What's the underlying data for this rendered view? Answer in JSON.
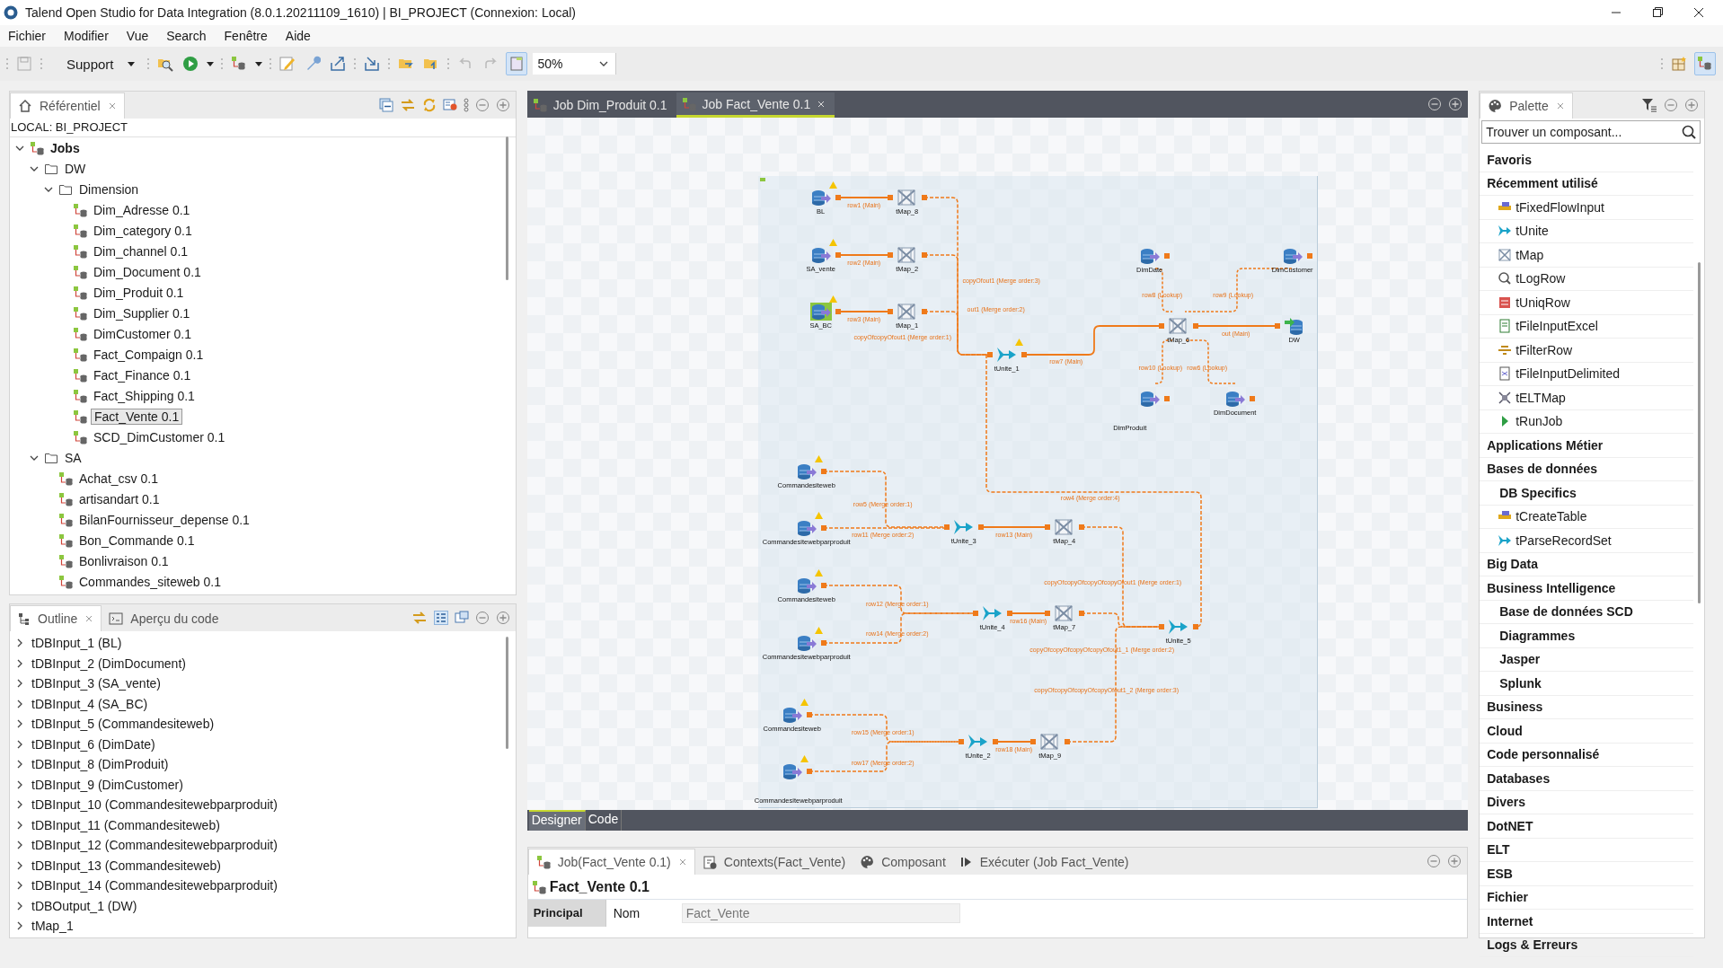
{
  "window": {
    "title": "Talend Open Studio for Data Integration (8.0.1.20211109_1610) | BI_PROJECT (Connexion: Local)"
  },
  "menu": [
    "Fichier",
    "Modifier",
    "Vue",
    "Search",
    "Fenêtre",
    "Aide"
  ],
  "toolbar": {
    "perspective": "Support",
    "zoom": "50%"
  },
  "repository": {
    "tab": "Référentiel",
    "location": "LOCAL: BI_PROJECT",
    "tree": [
      {
        "label": "Jobs",
        "kind": "root",
        "expanded": true,
        "selected": false,
        "children": [
          {
            "label": "DW",
            "kind": "folder",
            "expanded": true,
            "selected": false,
            "children": [
              {
                "label": "Dimension",
                "kind": "folder",
                "expanded": true,
                "selected": false,
                "children": [
                  {
                    "label": "Dim_Adresse 0.1",
                    "kind": "job",
                    "selected": false
                  },
                  {
                    "label": "Dim_category 0.1",
                    "kind": "job",
                    "selected": false
                  },
                  {
                    "label": "Dim_channel 0.1",
                    "kind": "job",
                    "selected": false
                  },
                  {
                    "label": "Dim_Document 0.1",
                    "kind": "job",
                    "selected": false
                  },
                  {
                    "label": "Dim_Produit 0.1",
                    "kind": "job",
                    "selected": false
                  },
                  {
                    "label": "Dim_Supplier 0.1",
                    "kind": "job",
                    "selected": false
                  },
                  {
                    "label": "DimCustomer 0.1",
                    "kind": "job",
                    "selected": false
                  },
                  {
                    "label": "Fact_Compaign 0.1",
                    "kind": "job",
                    "selected": false
                  },
                  {
                    "label": "Fact_Finance 0.1",
                    "kind": "job",
                    "selected": false
                  },
                  {
                    "label": "Fact_Shipping 0.1",
                    "kind": "job",
                    "selected": false
                  },
                  {
                    "label": "Fact_Vente 0.1",
                    "kind": "job",
                    "selected": true
                  },
                  {
                    "label": "SCD_DimCustomer 0.1",
                    "kind": "job",
                    "selected": false
                  }
                ]
              }
            ]
          },
          {
            "label": "SA",
            "kind": "folder",
            "expanded": true,
            "selected": false,
            "children": [
              {
                "label": "Achat_csv 0.1",
                "kind": "job",
                "selected": false
              },
              {
                "label": "artisandart 0.1",
                "kind": "job",
                "selected": false
              },
              {
                "label": "BilanFournisseur_depense 0.1",
                "kind": "job",
                "selected": false
              },
              {
                "label": "Bon_Commande 0.1",
                "kind": "job",
                "selected": false
              },
              {
                "label": "Bonlivraison 0.1",
                "kind": "job",
                "selected": false
              },
              {
                "label": "Commandes_siteweb 0.1",
                "kind": "job",
                "selected": false
              }
            ]
          }
        ]
      }
    ]
  },
  "outline": {
    "tabs": [
      {
        "label": "Outline",
        "selected": true
      },
      {
        "label": "Aperçu du code",
        "selected": false
      }
    ],
    "items": [
      {
        "label": "tDBInput_1 (BL)",
        "expanded": false
      },
      {
        "label": "tDBInput_2 (DimDocument)",
        "expanded": false
      },
      {
        "label": "tDBInput_3 (SA_vente)",
        "expanded": false
      },
      {
        "label": "tDBInput_4 (SA_BC)",
        "expanded": false
      },
      {
        "label": "tDBInput_5 (Commandesiteweb)",
        "expanded": false
      },
      {
        "label": "tDBInput_6 (DimDate)",
        "expanded": false
      },
      {
        "label": "tDBInput_8 (DimProduit)",
        "expanded": false
      },
      {
        "label": "tDBInput_9 (DimCustomer)",
        "expanded": false
      },
      {
        "label": "tDBInput_10 (Commandesitewebparproduit)",
        "expanded": false
      },
      {
        "label": "tDBInput_11 (Commandesiteweb)",
        "expanded": false
      },
      {
        "label": "tDBInput_12 (Commandesitewebparproduit)",
        "expanded": false
      },
      {
        "label": "tDBInput_13 (Commandesiteweb)",
        "expanded": false
      },
      {
        "label": "tDBInput_14 (Commandesitewebparproduit)",
        "expanded": false
      },
      {
        "label": "tDBOutput_1 (DW)",
        "expanded": false
      },
      {
        "label": "tMap_1",
        "expanded": false
      }
    ]
  },
  "editor": {
    "tabs": [
      {
        "label": "Job Dim_Produit 0.1",
        "selected": false
      },
      {
        "label": "Job Fact_Vente 0.1",
        "selected": true
      }
    ],
    "nodes": [
      {
        "label": "BL",
        "kind": "db_input",
        "warning": true,
        "selected": false
      },
      {
        "label": "tMap_8",
        "kind": "map",
        "warning": false,
        "selected": false
      },
      {
        "label": "SA_vente",
        "kind": "db_input",
        "warning": true,
        "selected": false
      },
      {
        "label": "tMap_2",
        "kind": "map",
        "warning": false,
        "selected": false
      },
      {
        "label": "SA_BC",
        "kind": "db_input",
        "warning": true,
        "selected": true
      },
      {
        "label": "tMap_1",
        "kind": "map",
        "warning": false,
        "selected": false
      },
      {
        "label": "DimDate",
        "kind": "db_input",
        "warning": false,
        "selected": false
      },
      {
        "label": "DimCustomer",
        "kind": "db_input",
        "warning": false,
        "selected": false
      },
      {
        "label": "tUnite_1",
        "kind": "unite",
        "warning": true,
        "selected": false
      },
      {
        "label": "tMap_6",
        "kind": "map",
        "warning": false,
        "selected": false
      },
      {
        "label": "DW",
        "kind": "db_output",
        "warning": false,
        "selected": false
      },
      {
        "label": "DimProduit",
        "kind": "db_input",
        "warning": false,
        "selected": false
      },
      {
        "label": "DimDocument",
        "kind": "db_input",
        "warning": false,
        "selected": false
      },
      {
        "label": "Commandesiteweb",
        "kind": "db_input",
        "warning": true,
        "selected": false
      },
      {
        "label": "Commandesitewebparproduit",
        "kind": "db_input",
        "warning": true,
        "selected": false
      },
      {
        "label": "tUnite_3",
        "kind": "unite",
        "warning": false,
        "selected": false
      },
      {
        "label": "tMap_4",
        "kind": "map",
        "warning": false,
        "selected": false
      },
      {
        "label": "Commandesiteweb",
        "kind": "db_input",
        "warning": true,
        "selected": false
      },
      {
        "label": "tUnite_4",
        "kind": "unite",
        "warning": false,
        "selected": false
      },
      {
        "label": "tMap_7",
        "kind": "map",
        "warning": false,
        "selected": false
      },
      {
        "label": "tUnite_5",
        "kind": "unite",
        "warning": false,
        "selected": false
      },
      {
        "label": "Commandesitewebparproduit",
        "kind": "db_input",
        "warning": true,
        "selected": false
      },
      {
        "label": "Commandesiteweb",
        "kind": "db_input",
        "warning": true,
        "selected": false
      },
      {
        "label": "tUnite_2",
        "kind": "unite",
        "warning": false,
        "selected": false
      },
      {
        "label": "tMap_9",
        "kind": "map",
        "warning": false,
        "selected": false
      },
      {
        "label": "Commandesitewebparproduit",
        "kind": "db_input",
        "warning": true,
        "selected": false
      }
    ],
    "links": [
      {
        "label": "row1 (Main)",
        "kind": "main"
      },
      {
        "label": "row2 (Main)",
        "kind": "main"
      },
      {
        "label": "row3 (Main)",
        "kind": "main"
      },
      {
        "label": "copyOfout1 (Merge order:3)",
        "kind": "merge"
      },
      {
        "label": "out1 (Merge order:2)",
        "kind": "merge"
      },
      {
        "label": "copyOfcopyOfout1 (Merge order:1)",
        "kind": "merge"
      },
      {
        "label": "row7 (Main)",
        "kind": "main"
      },
      {
        "label": "row8 (Lookup)",
        "kind": "lookup"
      },
      {
        "label": "row9 (Lookup)",
        "kind": "lookup"
      },
      {
        "label": "out (Main)",
        "kind": "main"
      },
      {
        "label": "row10 (Lookup)",
        "kind": "lookup"
      },
      {
        "label": "row6 (Lookup)",
        "kind": "lookup"
      },
      {
        "label": "row4 (Merge order:4)",
        "kind": "merge"
      },
      {
        "label": "row5 (Merge order:1)",
        "kind": "merge"
      },
      {
        "label": "row11 (Merge order:2)",
        "kind": "merge"
      },
      {
        "label": "row13 (Main)",
        "kind": "main"
      },
      {
        "label": "copyOfcopyOfcopyOfcopyOfout1 (Merge order:1)",
        "kind": "merge"
      },
      {
        "label": "row12 (Merge order:1)",
        "kind": "merge"
      },
      {
        "label": "row14 (Merge order:2)",
        "kind": "merge"
      },
      {
        "label": "row16 (Main)",
        "kind": "main"
      },
      {
        "label": "copyOfcopyOfcopyOfcopyOfout1_1 (Merge order:2)",
        "kind": "merge"
      },
      {
        "label": "row15 (Merge order:1)",
        "kind": "merge"
      },
      {
        "label": "row17 (Merge order:2)",
        "kind": "merge"
      },
      {
        "label": "row18 (Main)",
        "kind": "main"
      },
      {
        "label": "copyOfcopyOfcopyOfcopyOfout1_2 (Merge order:3)",
        "kind": "merge"
      }
    ],
    "view_tabs": [
      {
        "label": "Designer",
        "selected": true
      },
      {
        "label": "Code",
        "selected": false
      }
    ]
  },
  "properties": {
    "tabs": [
      {
        "label": "Job(Fact_Vente 0.1)",
        "kind": "job",
        "selected": true
      },
      {
        "label": "Contexts(Fact_Vente)",
        "kind": "contexts",
        "selected": false
      },
      {
        "label": "Composant",
        "kind": "component",
        "selected": false
      },
      {
        "label": "Exécuter (Job Fact_Vente)",
        "kind": "run",
        "selected": false
      }
    ],
    "heading": "Fact_Vente 0.1",
    "section": "Principal",
    "field_label": "Nom",
    "field_value": "Fact_Vente"
  },
  "palette": {
    "tab": "Palette",
    "search": {
      "placeholder": "Trouver un composant..."
    },
    "items": [
      {
        "label": "Favoris",
        "kind": "category"
      },
      {
        "label": "Récemment utilisé",
        "kind": "category"
      },
      {
        "label": "tFixedFlowInput",
        "kind": "component"
      },
      {
        "label": "tUnite",
        "kind": "component"
      },
      {
        "label": "tMap",
        "kind": "component"
      },
      {
        "label": "tLogRow",
        "kind": "component"
      },
      {
        "label": "tUniqRow",
        "kind": "component"
      },
      {
        "label": "tFileInputExcel",
        "kind": "component"
      },
      {
        "label": "tFilterRow",
        "kind": "component"
      },
      {
        "label": "tFileInputDelimited",
        "kind": "component"
      },
      {
        "label": "tELTMap",
        "kind": "component"
      },
      {
        "label": "tRunJob",
        "kind": "component"
      },
      {
        "label": "Applications Métier",
        "kind": "category"
      },
      {
        "label": "Bases de données",
        "kind": "category"
      },
      {
        "label": "DB Specifics",
        "kind": "subcategory"
      },
      {
        "label": "tCreateTable",
        "kind": "component"
      },
      {
        "label": "tParseRecordSet",
        "kind": "component"
      },
      {
        "label": "Big Data",
        "kind": "category"
      },
      {
        "label": "Business Intelligence",
        "kind": "category"
      },
      {
        "label": "Base de données SCD",
        "kind": "subcategory"
      },
      {
        "label": "Diagrammes",
        "kind": "subcategory"
      },
      {
        "label": "Jasper",
        "kind": "subcategory"
      },
      {
        "label": "Splunk",
        "kind": "subcategory"
      },
      {
        "label": "Business",
        "kind": "category"
      },
      {
        "label": "Cloud",
        "kind": "category"
      },
      {
        "label": "Code personnalisé",
        "kind": "category"
      },
      {
        "label": "Databases",
        "kind": "category"
      },
      {
        "label": "Divers",
        "kind": "category"
      },
      {
        "label": "DotNET",
        "kind": "category"
      },
      {
        "label": "ELT",
        "kind": "category"
      },
      {
        "label": "ESB",
        "kind": "category"
      },
      {
        "label": "Fichier",
        "kind": "category"
      },
      {
        "label": "Internet",
        "kind": "category"
      },
      {
        "label": "Logs & Erreurs",
        "kind": "category"
      }
    ]
  }
}
